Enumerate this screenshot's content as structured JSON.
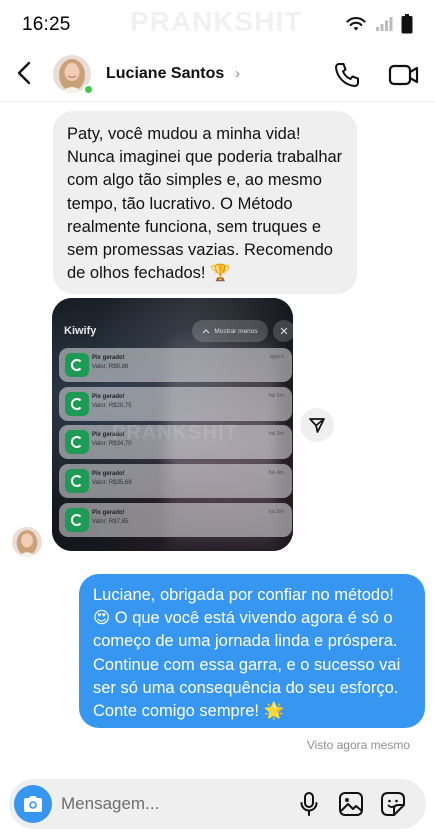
{
  "status_bar": {
    "time": "16:25",
    "watermark": "PRANKSHIT"
  },
  "header": {
    "contact_name": "Luciane Santos",
    "chevron": "›",
    "online_color": "#3ec94d"
  },
  "messages": {
    "received_text": "Paty, você mudou a minha vida! Nunca imaginei que poderia trabalhar com algo tão simples e, ao mesmo tempo, tão lucrativo. O Método realmente funciona, sem truques e sem promessas vazias. Recomendo de olhos fechados! 🏆",
    "attachment": {
      "app_name": "Kiwify",
      "show_less": "Mostrar menos",
      "watermark": "PRANKSHIT",
      "notifications": [
        {
          "title": "Pix gerado!",
          "value": "Valor: R$8,88",
          "time": "agora"
        },
        {
          "title": "Pix gerado!",
          "value": "Valor: R$20,75",
          "time": "há 1m"
        },
        {
          "title": "Pix gerado!",
          "value": "Valor: R$34,70",
          "time": "há 2m"
        },
        {
          "title": "Pix gerado!",
          "value": "Valor: R$35,69",
          "time": "há 4m"
        },
        {
          "title": "Pix gerado!",
          "value": "Valor: R$7,85",
          "time": "há 5m"
        }
      ]
    },
    "sent_text": "Luciane, obrigada por confiar no método! 😍 O que você está vivendo agora é só o começo de uma jornada linda e próspera. Continue com essa garra, e o sucesso vai ser só uma consequência do seu esforço. Conte comigo sempre! 🌟",
    "seen_status": "Visto agora mesmo",
    "sent_color": "#3797f0"
  },
  "composer": {
    "placeholder": "Mensagem...",
    "icons": [
      "camera-icon",
      "microphone-icon",
      "gallery-icon",
      "sticker-icon"
    ]
  }
}
